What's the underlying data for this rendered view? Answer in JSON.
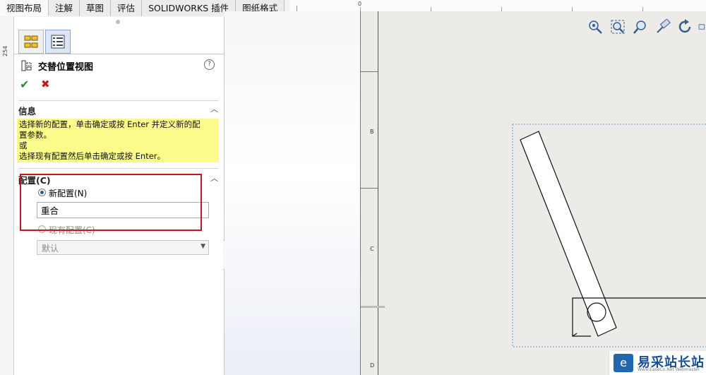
{
  "tabs": [
    {
      "label": "视图布局",
      "active": true
    },
    {
      "label": "注解",
      "active": false
    },
    {
      "label": "草图",
      "active": false
    },
    {
      "label": "评估",
      "active": false
    },
    {
      "label": "SOLIDWORKS 插件",
      "active": false
    },
    {
      "label": "图纸格式",
      "active": false
    }
  ],
  "ruler": {
    "top_zero": "0",
    "left_value": "254"
  },
  "pm": {
    "title": "交替位置视图",
    "help": "?",
    "info": {
      "title": "信息",
      "lines": [
        "选择新的配置，单击确定或按 Enter 并定义新的配",
        "置参数。",
        "或",
        "选择现有配置然后单击确定或按 Enter。"
      ]
    },
    "config": {
      "title": "配置(C)",
      "new_label": "新配置(N)",
      "new_value": "重合",
      "existing_label": "现有配置(C)",
      "existing_value": "默认"
    }
  },
  "sheet": {
    "zones": [
      "B",
      "C",
      "D"
    ]
  },
  "watermark": {
    "text": "易采站长站",
    "sub": "Www.EaseCn.Net Webmaster"
  },
  "colors": {
    "highlight": "#c6161d",
    "info_bg": "#fbfb8c",
    "accent": "#1c5ea8"
  }
}
